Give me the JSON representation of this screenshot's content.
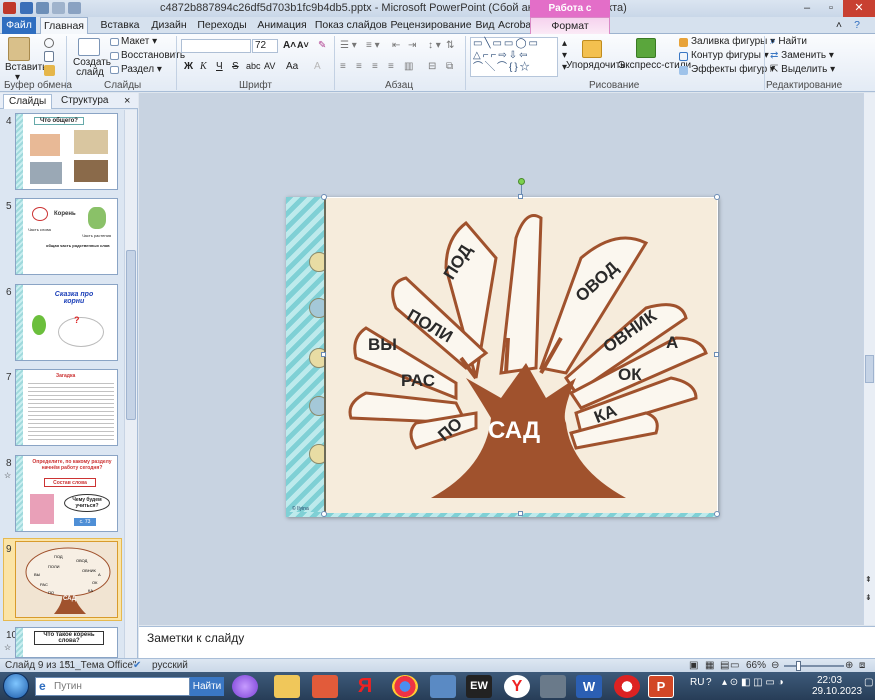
{
  "window": {
    "title": "c4872b887894c26df5d703b1fc9b4db5.pptx - Microsoft PowerPoint (Сбой активации продукта)",
    "contextual_group": "Работа с рисунками"
  },
  "tabs": [
    "Файл",
    "Главная",
    "Вставка",
    "Дизайн",
    "Переходы",
    "Анимация",
    "Показ слайдов",
    "Рецензирование",
    "Вид",
    "Acrobat",
    "Формат"
  ],
  "ribbon": {
    "clipboard": {
      "paste": "Вставить",
      "label": "Буфер обмена"
    },
    "slides": {
      "create": "Создать слайд",
      "layout": "Макет",
      "reset": "Восстановить",
      "section": "Раздел",
      "label": "Слайды"
    },
    "font": {
      "size": "72",
      "label": "Шрифт",
      "bold": "Ж",
      "italic": "К",
      "underline": "Ч",
      "strike": "S",
      "shadow": "abc",
      "spacing": "AV",
      "case": "Aa",
      "color": "A"
    },
    "paragraph": {
      "label": "Абзац"
    },
    "drawing": {
      "arrange": "Упорядочить",
      "quick_styles": "Экспресс-стили",
      "fill": "Заливка фигуры",
      "outline": "Контур фигуры",
      "effects": "Эффекты фигур",
      "label": "Рисование"
    },
    "editing": {
      "find": "Найти",
      "replace": "Заменить",
      "select": "Выделить",
      "label": "Редактирование"
    }
  },
  "pane": {
    "tab_slides": "Слайды",
    "tab_outline": "Структура",
    "close": "×",
    "thumbnails": [
      {
        "num": "4",
        "title": "Что общего?"
      },
      {
        "num": "5",
        "title": "Корень"
      },
      {
        "num": "6",
        "title": "Сказка про корни"
      },
      {
        "num": "7",
        "title": "Загадка"
      },
      {
        "num": "8",
        "title": "Определите, по какому разделу начнём работу сегодня?"
      },
      {
        "num": "9",
        "title": ""
      },
      {
        "num": "10",
        "title": "Что такое корень слова?"
      }
    ],
    "thumb_details": {
      "t5_left": "Часть слова",
      "t5_right": "Часть растения",
      "t5_bottom": "общая часть родственных слов",
      "t6_q": "?",
      "t8_sub": "Состав слова",
      "t8_q": "Чему будем учиться?",
      "t8_foot": "с. 73"
    }
  },
  "slide9_thumb": {
    "words": [
      "ПОД",
      "ОВОД",
      "ПОЛИ",
      "ВЫ",
      "ОВНИК",
      "А",
      "РАС",
      "ОК",
      "ПО",
      "КА",
      "САД"
    ]
  },
  "slide": {
    "root": "САД",
    "words": [
      "ПОД",
      "ОВОД",
      "ПОЛИ",
      "ВЫ",
      "ОВНИК",
      "А",
      "РАС",
      "ОК",
      "ПО",
      "КА"
    ],
    "copyright": "© Ilyina"
  },
  "notes": {
    "placeholder": "Заметки к слайду"
  },
  "status": {
    "slide_counter": "Слайд 9 из 15",
    "theme": "\"1_Тема Office\"",
    "language": "русский",
    "zoom": "66%"
  },
  "taskbar": {
    "search_placeholder": "Путин",
    "search_button": "Найти",
    "lang": "RU",
    "time": "22:03",
    "date": "29.10.2023"
  }
}
